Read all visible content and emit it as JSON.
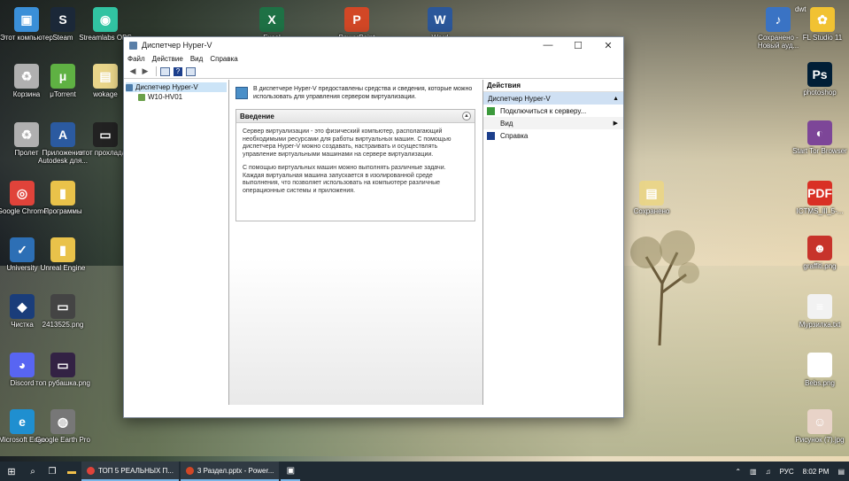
{
  "desktop": {
    "icons_left": [
      {
        "label": "Этот компьютер",
        "color": "#3a8fd8",
        "glyph": "▣"
      },
      {
        "label": "Steam",
        "color": "#1b2838",
        "glyph": "S"
      },
      {
        "label": "Streamlabs OBS",
        "color": "#31c3a2",
        "glyph": "◉"
      },
      {
        "label": "Корзина",
        "color": "#b0b0b0",
        "glyph": "♻"
      },
      {
        "label": "μTorrent",
        "color": "#5fb143",
        "glyph": "μ"
      },
      {
        "label": "wokage",
        "color": "#e9d58a",
        "glyph": "▤"
      },
      {
        "label": "Пролет",
        "color": "#b0b0b0",
        "glyph": "♻"
      },
      {
        "label": "Приложение Autodesk для...",
        "color": "#2b5aa0",
        "glyph": "A"
      },
      {
        "label": "этот прохлада...",
        "color": "#222222",
        "glyph": "▭"
      },
      {
        "label": "Google Chrome",
        "color": "#e0433a",
        "glyph": "◎"
      },
      {
        "label": "Программы",
        "color": "#e9c24a",
        "glyph": "▮"
      },
      {
        "label": "University",
        "color": "#2d6fb5",
        "glyph": "✓"
      },
      {
        "label": "Unreal Engine",
        "color": "#e9c24a",
        "glyph": "▮"
      },
      {
        "label": "Чистка",
        "color": "#1a3d7a",
        "glyph": "◆"
      },
      {
        "label": "2413525.png",
        "color": "#444444",
        "glyph": "▭"
      },
      {
        "label": "Discord",
        "color": "#5865f2",
        "glyph": "◕"
      },
      {
        "label": "топ рубашка.png",
        "color": "#332244",
        "glyph": "▭"
      },
      {
        "label": "Microsoft Edge",
        "color": "#1f8fd0",
        "glyph": "e"
      },
      {
        "label": "Google Earth Pro",
        "color": "#777777",
        "glyph": "◍"
      }
    ],
    "icons_top": [
      {
        "label": "Excel",
        "color": "#1e7145",
        "glyph": "X"
      },
      {
        "label": "PowerPoint",
        "color": "#d24726",
        "glyph": "P"
      },
      {
        "label": "Word",
        "color": "#2b579a",
        "glyph": "W"
      }
    ],
    "icons_right": [
      {
        "label": "Сохранено - Новый ауд...",
        "color": "#3a73c4",
        "glyph": "♪"
      },
      {
        "label": "FL Studio 11",
        "color": "#f1c232",
        "glyph": "✿"
      },
      {
        "label": "photoshop",
        "color": "#001e36",
        "glyph": "Ps"
      },
      {
        "label": "Start Tor Browser",
        "color": "#7d4698",
        "glyph": "◐"
      },
      {
        "label": "Сохранено",
        "color": "#e9d58a",
        "glyph": "▤"
      },
      {
        "label": "ICTMS_lll_5-...",
        "color": "#d93025",
        "glyph": "PDF"
      },
      {
        "label": "graffiti.png",
        "color": "#c7332b",
        "glyph": "☻"
      },
      {
        "label": "Мурзилка.txt",
        "color": "#f2f2f2",
        "glyph": "≡"
      },
      {
        "label": "Bebs.png",
        "color": "#ffffff",
        "glyph": "Λ"
      },
      {
        "label": "Рисунок (7).jpg",
        "color": "#e8d3c8",
        "glyph": "☺"
      }
    ],
    "corner_text": "dwt"
  },
  "window": {
    "title": "Диспетчер Hyper-V",
    "controls": {
      "minimize": "—",
      "maximize": "☐",
      "close": "✕"
    },
    "menu": [
      "Файл",
      "Действие",
      "Вид",
      "Справка"
    ],
    "tree": {
      "root": "Диспетчер Hyper-V",
      "child": "W10-HV01"
    },
    "center": {
      "info": "В диспетчере Hyper-V предоставлены средства и сведения, которые можно использовать для управления сервером виртуализации.",
      "intro_title": "Введение",
      "intro_p1": "Сервер виртуализации - это физический компьютер, располагающий необходимыми ресурсами для работы виртуальных машин. С помощью диспетчера Hyper-V можно создавать, настраивать и осуществлять управление виртуальными машинами на сервере виртуализации.",
      "intro_p2": "С помощью виртуальных машин можно выполнять различные задачи. Каждая виртуальная машина запускается в изолированной среде выполнения, что позволяет использовать на компьютере различные операционные системы и приложения."
    },
    "actions": {
      "title": "Действия",
      "group": "Диспетчер Hyper-V",
      "items": [
        {
          "label": "Подключиться к серверу...",
          "icon_color": "#3c9a3c"
        },
        {
          "label": "Вид",
          "icon_color": "",
          "submenu": "▶"
        },
        {
          "label": "Справка",
          "icon_color": "#1c3f8c"
        }
      ]
    }
  },
  "taskbar": {
    "apps": [
      {
        "label": "ТОП 5 РЕАЛЬНЫХ П...",
        "color": "#e0433a"
      },
      {
        "label": "3 Раздел.pptx - Power...",
        "color": "#d24726"
      }
    ],
    "lang": "РУС",
    "time": "8:02 PM"
  }
}
